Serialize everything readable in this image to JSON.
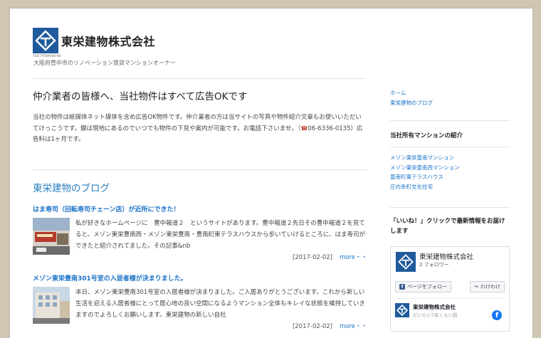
{
  "header": {
    "logo_small_text": "TOEI TATEMONO KK",
    "company_name": "東栄建物株式会社",
    "tagline": "大阪府豊中市のリノベーション賃貸マンションオーナー"
  },
  "main": {
    "heading": "仲介業者の皆様へ、当社物件はすべて広告OKです",
    "intro_text": "当社の物件は紙媒体ネット媒体を含め広告OK物件です。仲介業者の方は当サイトの写真や物件紹介文章もお使いいただいてけっこうです。鍵は現地にあるのでいつでも物件の下見や案内が可能です。お電話下さいませ。（",
    "tel_icon": "☎",
    "intro_tail": "06-6336-0135）広告料は1ヶ月です。",
    "blog_heading": "東栄建物のブログ",
    "posts": [
      {
        "title": "はま寿司（回転寿司チェーン店）が近所にできた！",
        "excerpt": "私が好きなホームページに　豊中報道２　というサイトがあります。豊中報道２先日その豊中報道２を見てると、メゾン東栄豊南西・メゾン東栄豊南・豊南町東テラスハウスから歩いていけるところに、はま寿司ができたと紹介されてました。その記事&nb",
        "date": "[2017-02-02]",
        "more": "more・・"
      },
      {
        "title": "メゾン東栄豊南301号室の入居者様が決まりました。",
        "excerpt": "本日、メゾン東栄豊南301号室の入居者様が決まりました。ご入居ありがとうございます。これから新しい生活を迎える入居者様にとって居心地の良い空間になるようマンション全体もキレイな状態を維持していきますのでよろしくお願いします。東栄建物の新しい自社",
        "date": "[2017-02-02]",
        "more": "more・・"
      }
    ]
  },
  "sidebar": {
    "nav": [
      "ホーム",
      "東栄建物のブログ"
    ],
    "mansion_heading": "当社所有マンションの紹介",
    "mansions": [
      "メゾン東栄豊南マンション",
      "メゾン東栄豊南西マンション",
      "豊南町東テラスハウス",
      "庄内幸町文化住宅"
    ],
    "like_heading": "「いいね！」クリックで最新情報をお届けします",
    "facebook": {
      "page_name": "東栄建物株式会社",
      "followers": "2 フォロワー",
      "follow_button": "ページをフォロー",
      "share_button": "わけわけ",
      "post_name": "東栄建物株式会社",
      "post_time": "だいたい7年くらい前"
    }
  },
  "colors": {
    "link": "#1a73c8",
    "brand": "#1f5a9c",
    "background": "#cfc6b4"
  }
}
